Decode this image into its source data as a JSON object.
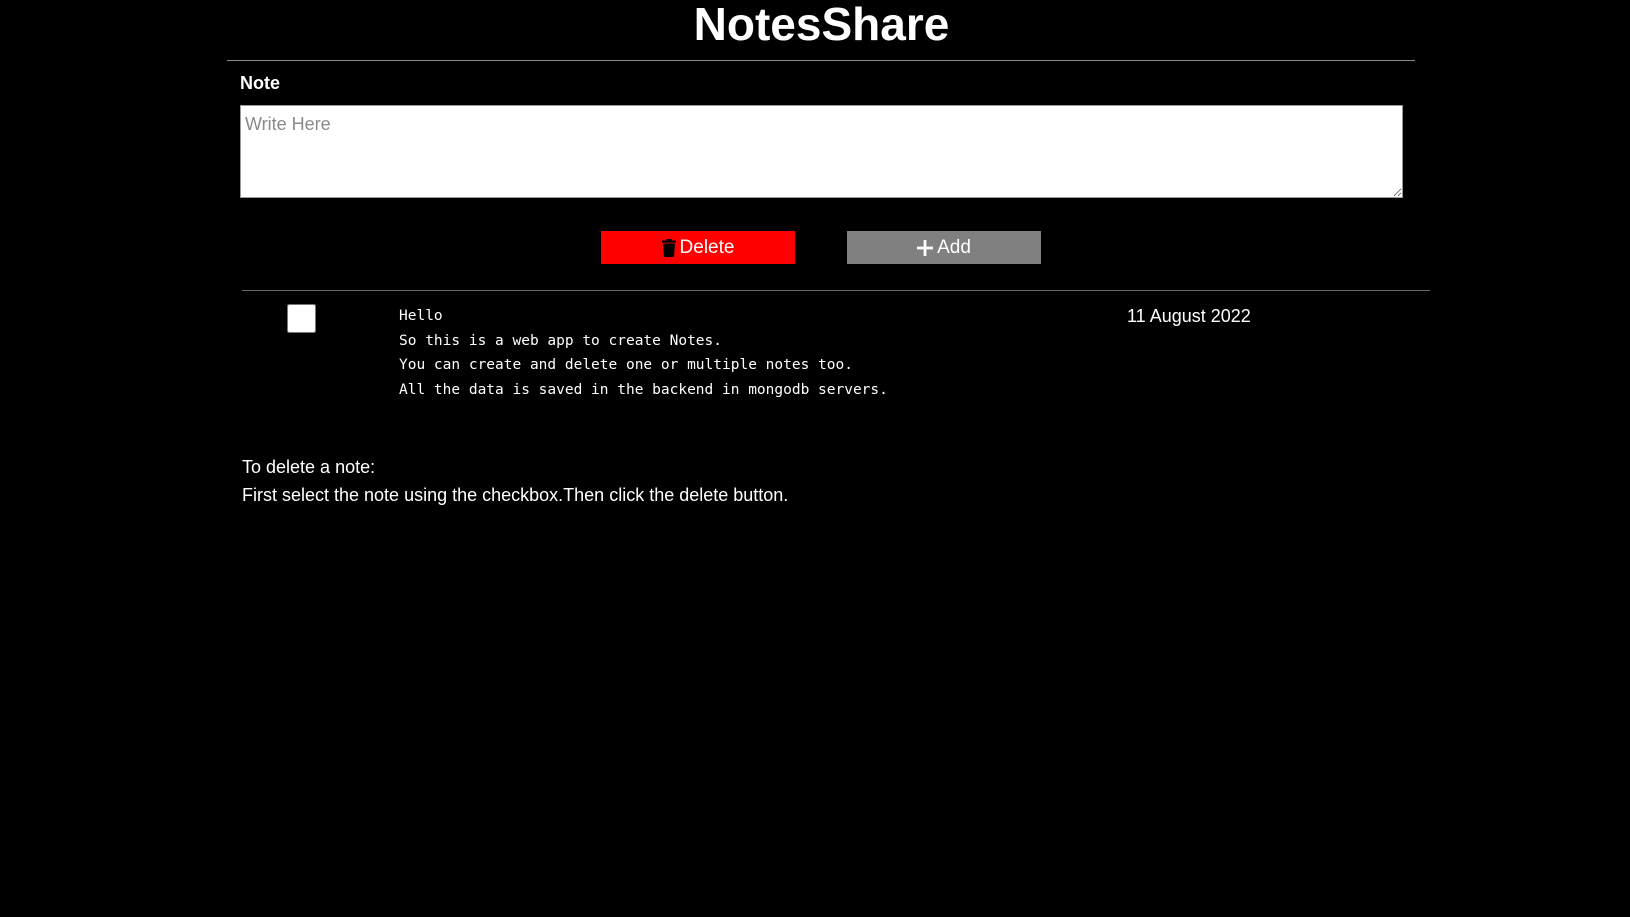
{
  "app": {
    "title": "NotesShare"
  },
  "form": {
    "label": "Note",
    "placeholder": "Write Here",
    "value": ""
  },
  "buttons": {
    "delete_label": "Delete",
    "delete_icon": "trash-icon",
    "add_label": "Add",
    "add_icon": "plus-icon"
  },
  "notes": [
    {
      "checked": false,
      "lines": [
        "Hello",
        "So this is a web app to create Notes.",
        "You can create and delete one or multiple notes too.",
        "All the data is saved in the backend in mongodb servers."
      ],
      "date": "11 August 2022"
    }
  ],
  "help": {
    "line1": "To delete a note:",
    "line2": "First select the note using the checkbox.Then click the delete button."
  },
  "colors": {
    "background": "#000000",
    "text": "#ffffff",
    "delete_button": "#ff0000",
    "add_button": "#808080"
  }
}
